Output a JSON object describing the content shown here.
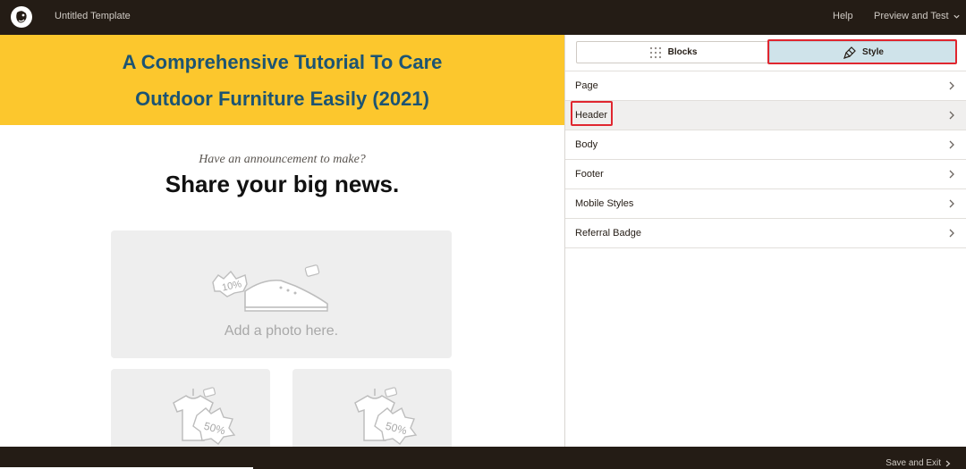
{
  "topbar": {
    "app_title": "Untitled Template",
    "help": "Help",
    "preview_test": "Preview and Test"
  },
  "email": {
    "title_line1": "A Comprehensive Tutorial To Care",
    "title_line2": "Outdoor Furniture Easily (2021)",
    "announcement": "Have an announcement to make?",
    "headline": "Share your big news.",
    "photo_placeholder": "Add a photo here.",
    "shoe_tag": "10%",
    "shirt_tag_1": "50%",
    "shirt_tag_2": "50%"
  },
  "panel": {
    "tabs": [
      {
        "label": "Blocks",
        "icon": "grid-icon"
      },
      {
        "label": "Style",
        "icon": "paintbrush-icon",
        "selected": true
      }
    ],
    "menu": [
      {
        "label": "Page"
      },
      {
        "label": "Header",
        "highlighted": true
      },
      {
        "label": "Body"
      },
      {
        "label": "Footer"
      },
      {
        "label": "Mobile Styles"
      },
      {
        "label": "Referral Badge"
      }
    ]
  },
  "bottombar": {
    "save_exit": "Save and Exit"
  },
  "colors": {
    "topbar": "#241c15",
    "header_bg": "#fcc72d",
    "title_text": "#1c5473",
    "selected_tab": "#cfe3ea",
    "highlight": "#e0262f"
  }
}
